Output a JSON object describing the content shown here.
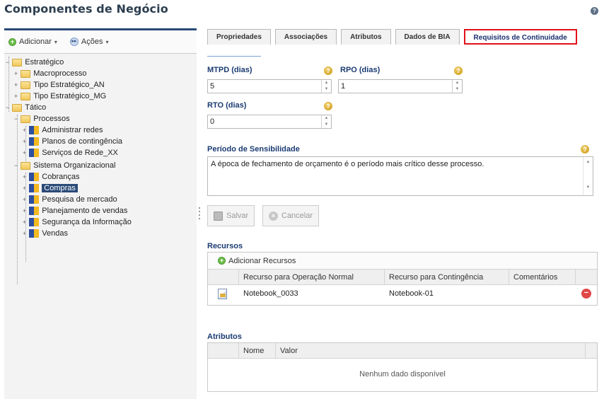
{
  "page": {
    "title": "Componentes de Negócio"
  },
  "left": {
    "add_label": "Adicionar",
    "actions_label": "Ações",
    "tree": [
      {
        "label": "Estratégico",
        "type": "folder"
      },
      {
        "label": "Macroprocesso",
        "type": "folder"
      },
      {
        "label": "Tipo Estratégico_AN",
        "type": "folder"
      },
      {
        "label": "Tipo Estratégico_MG",
        "type": "folder"
      },
      {
        "label": "Tático",
        "type": "folder"
      },
      {
        "label": "Processos",
        "type": "folder"
      },
      {
        "label": "Administrar redes",
        "type": "component"
      },
      {
        "label": "Planos de contingência",
        "type": "component"
      },
      {
        "label": "Serviços de Rede_XX",
        "type": "component"
      },
      {
        "label": "Sistema Organizacional",
        "type": "folder"
      },
      {
        "label": "Cobranças",
        "type": "component"
      },
      {
        "label": "Compras",
        "type": "component",
        "selected": true
      },
      {
        "label": "Pesquisa de mercado",
        "type": "component"
      },
      {
        "label": "Planejamento de vendas",
        "type": "component"
      },
      {
        "label": "Segurança da Informação",
        "type": "component"
      },
      {
        "label": "Vendas",
        "type": "component"
      }
    ]
  },
  "tabs": [
    {
      "label": "Propriedades"
    },
    {
      "label": "Associações"
    },
    {
      "label": "Atributos"
    },
    {
      "label": "Dados de BIA"
    },
    {
      "label": "Requisitos de Continuidade",
      "active": true
    }
  ],
  "form": {
    "mtpd_label": "MTPD (dias)",
    "mtpd_value": "5",
    "rpo_label": "RPO (dias)",
    "rpo_value": "1",
    "rto_label": "RTO (dias)",
    "rto_value": "0",
    "sensitivity_label": "Período de Sensibilidade",
    "sensitivity_value": "A época de fechamento de orçamento é o período mais crítico desse processo.",
    "help_glyph": "?",
    "spin_up": "▲",
    "spin_down": "▼"
  },
  "buttons": {
    "save": "Salvar",
    "cancel": "Cancelar"
  },
  "resources": {
    "title": "Recursos",
    "add_label": "Adicionar Recursos",
    "columns": [
      "Recurso para Operação Normal",
      "Recurso para Contingência",
      "Comentários"
    ],
    "rows": [
      {
        "normal": "Notebook_0033",
        "contingency": "Notebook-01",
        "comments": ""
      }
    ]
  },
  "attributes": {
    "title": "Atributos",
    "columns": [
      "Nome",
      "Valor"
    ],
    "empty_text": "Nenhum dado disponível"
  }
}
